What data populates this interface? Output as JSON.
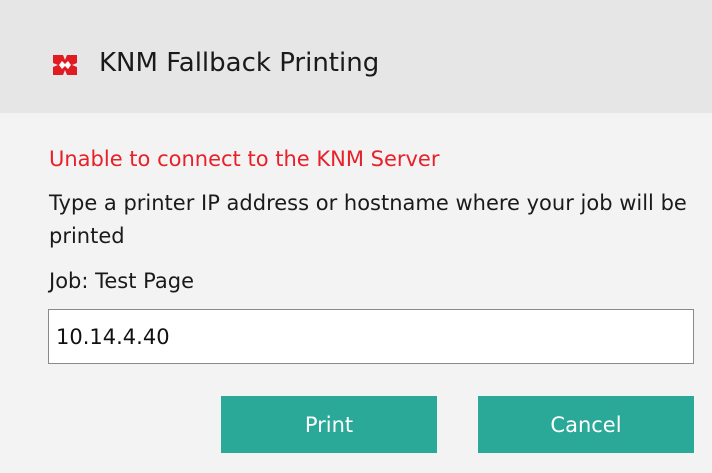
{
  "dialog": {
    "title": "KNM Fallback Printing",
    "logo_icon": "kyocera-logo-icon",
    "logo_color": "#e11b22"
  },
  "message": {
    "error": "Unable to connect to the KNM Server",
    "instructions": "Type a printer IP address or hostname where your job will be printed",
    "job_line": "Job: Test Page",
    "error_color": "#e8202a"
  },
  "printer_field": {
    "value": "10.14.4.40"
  },
  "buttons": {
    "print_label": "Print",
    "cancel_label": "Cancel",
    "accent_color": "#2aa998"
  }
}
